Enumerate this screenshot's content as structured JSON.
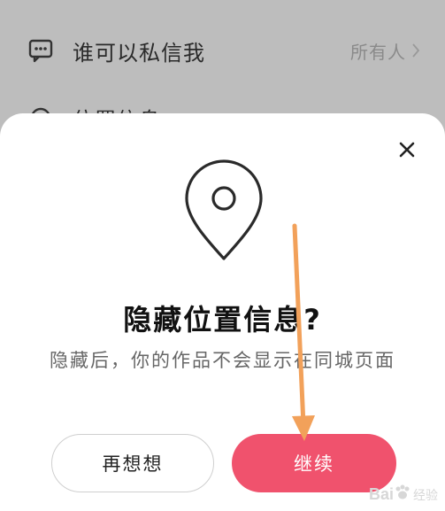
{
  "background_list": {
    "row1": {
      "label": "谁可以私信我",
      "value": "所有人",
      "icon": "message-dots-icon"
    },
    "row2": {
      "label": "位置信息",
      "icon": "location-icon"
    }
  },
  "dialog": {
    "icon": "location-pin-icon",
    "title": "隐藏位置信息?",
    "description": "隐藏后，你的作品不会显示在同城页面",
    "cancel_label": "再想想",
    "confirm_label": "继续",
    "close_icon": "close-icon"
  },
  "colors": {
    "accent": "#f0526d",
    "annotation_arrow": "#f2a15a",
    "overlay": "#bdbdbd"
  },
  "watermark": {
    "text": "Bai",
    "sub": "经验"
  }
}
